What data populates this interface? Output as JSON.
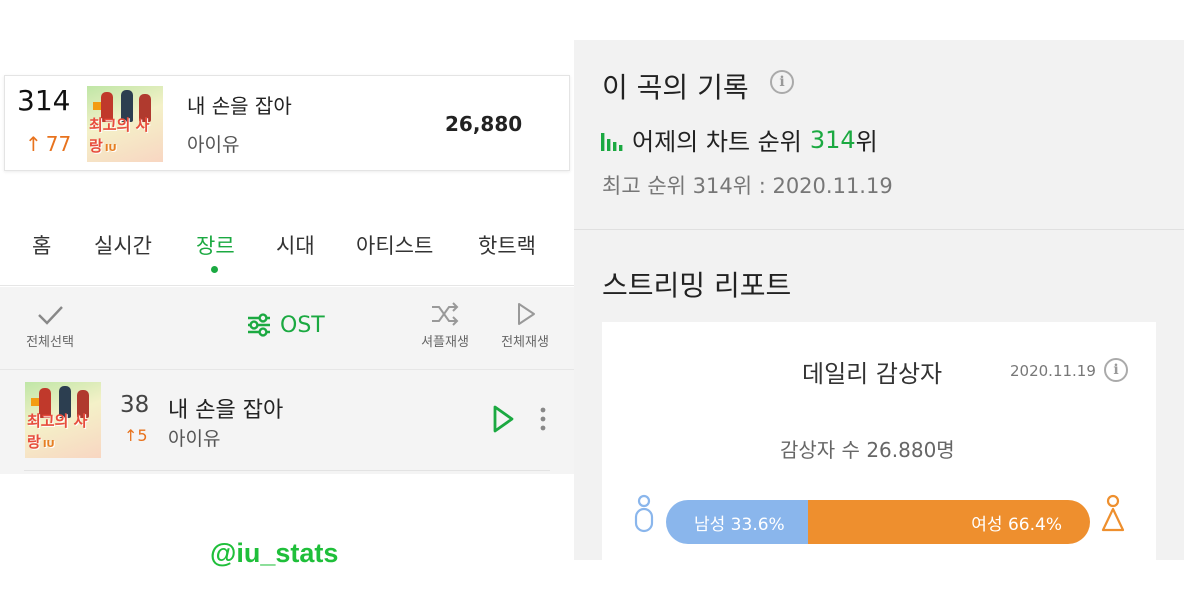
{
  "chart_entry": {
    "rank": "314",
    "change": "77",
    "title": "내 손을 잡아",
    "artist": "아이유",
    "listeners": "26,880"
  },
  "album_cover": {
    "text": "최고의 사랑",
    "badge": "IU"
  },
  "nav": {
    "tabs": [
      {
        "label": "홈",
        "active": false
      },
      {
        "label": "실시간",
        "active": false
      },
      {
        "label": "장르",
        "active": true
      },
      {
        "label": "시대",
        "active": false
      },
      {
        "label": "아티스트",
        "active": false
      },
      {
        "label": "핫트랙",
        "active": false
      }
    ]
  },
  "toolbar": {
    "select_all": "전체선택",
    "genre": "OST",
    "shuffle": "셔플재생",
    "play_all": "전체재생"
  },
  "song_item": {
    "rank": "38",
    "change": "5",
    "title": "내 손을 잡아",
    "artist": "아이유"
  },
  "watermark": "@iu_stats",
  "record": {
    "title": "이 곡의 기록",
    "yesterday_prefix": "어제의 차트 순위",
    "yesterday_rank": "314",
    "yesterday_suffix": "위",
    "best_rank": "최고 순위 314위 : 2020.11.19"
  },
  "report": {
    "title": "스트리밍 리포트",
    "daily_title": "데일리 감상자",
    "date": "2020.11.19",
    "listener_count": "감상자 수 26.880명",
    "male_label": "남성 33.6%",
    "female_label": "여성 66.4%",
    "male_share": 33.6,
    "female_share": 66.4
  },
  "colors": {
    "accent_green": "#1ba941",
    "up_orange": "#e8731e",
    "male_blue": "#8ab6ec",
    "female_orange": "#ee8f2e"
  },
  "icons": [
    "up-arrow-icon",
    "check-icon",
    "equalizer-icon",
    "shuffle-icon",
    "play-icon",
    "more-vertical-icon",
    "info-icon",
    "bar-chart-icon",
    "male-person-icon",
    "female-person-icon"
  ]
}
